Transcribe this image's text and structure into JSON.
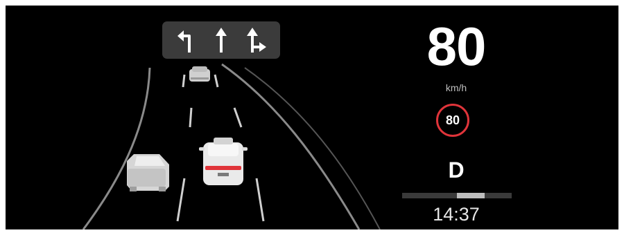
{
  "navigation": {
    "lanes": [
      {
        "direction": "turn-left",
        "icon": "turn-left-arrow-icon"
      },
      {
        "direction": "straight",
        "icon": "straight-arrow-icon"
      },
      {
        "direction": "straight-or-right",
        "icon": "straight-right-arrow-icon"
      }
    ]
  },
  "vehicle": {
    "speed": "80",
    "speed_unit": "km/h",
    "speed_limit": "80",
    "gear": "D",
    "time": "14:37"
  },
  "gear_indicator": {
    "segments": 4,
    "active_segment": 3
  },
  "colors": {
    "background": "#000000",
    "limit_ring": "#e0343a",
    "lane_panel": "#3b3b3b",
    "car": "#e8e8e8"
  }
}
